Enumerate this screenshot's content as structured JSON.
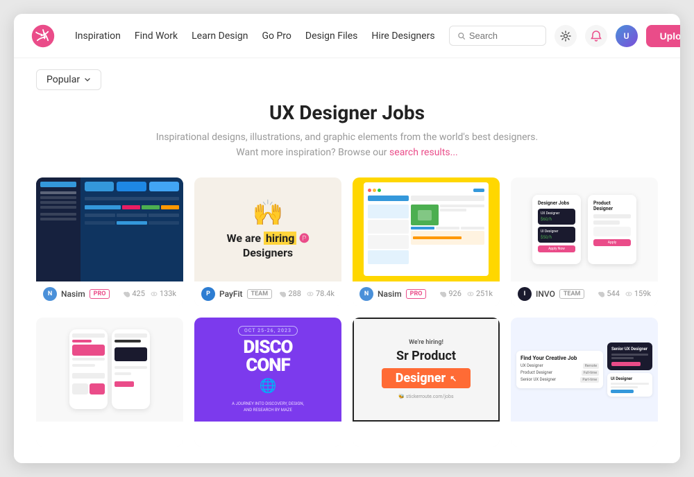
{
  "navbar": {
    "logo_text": "dribbble",
    "nav_items": [
      "Inspiration",
      "Find Work",
      "Learn Design",
      "Go Pro",
      "Design Files",
      "Hire Designers"
    ],
    "search_placeholder": "Search",
    "upload_label": "Upload"
  },
  "filter": {
    "popular_label": "Popular"
  },
  "page_header": {
    "title": "UX Designer Jobs",
    "subtitle_1": "Inspirational designs, illustrations, and graphic elements from the world's best designers.",
    "subtitle_2": "Want more inspiration? Browse our",
    "subtitle_link": "search results...",
    "subtitle_end": ""
  },
  "shots": [
    {
      "id": "shot-1",
      "author": "Nasim",
      "badge": "PRO",
      "badge_type": "pro",
      "likes": "425",
      "views": "133k",
      "type": "dark-ui"
    },
    {
      "id": "shot-2",
      "author": "PayFit",
      "badge": "TEAM",
      "badge_type": "team",
      "likes": "288",
      "views": "78.4k",
      "type": "hiring"
    },
    {
      "id": "shot-3",
      "author": "Nasim",
      "badge": "PRO",
      "badge_type": "pro",
      "likes": "926",
      "views": "251k",
      "type": "app-ui"
    },
    {
      "id": "shot-4",
      "author": "INVO",
      "badge": "TEAM",
      "badge_type": "team",
      "likes": "544",
      "views": "159k",
      "type": "designer-jobs"
    },
    {
      "id": "shot-5",
      "author": "",
      "badge": "",
      "badge_type": "",
      "likes": "",
      "views": "",
      "type": "phone-mockups"
    },
    {
      "id": "shot-6",
      "author": "",
      "badge": "",
      "badge_type": "",
      "likes": "",
      "views": "",
      "type": "disco-conf"
    },
    {
      "id": "shot-7",
      "author": "",
      "badge": "",
      "badge_type": "",
      "likes": "",
      "views": "",
      "type": "sr-product"
    },
    {
      "id": "shot-8",
      "author": "",
      "badge": "",
      "badge_type": "",
      "likes": "",
      "views": "",
      "type": "find-job"
    }
  ],
  "colors": {
    "accent": "#ea4c89",
    "dark_nav": "#1a1a2e",
    "disco_purple": "#7c3aed",
    "sr_orange": "#ff6b35"
  }
}
